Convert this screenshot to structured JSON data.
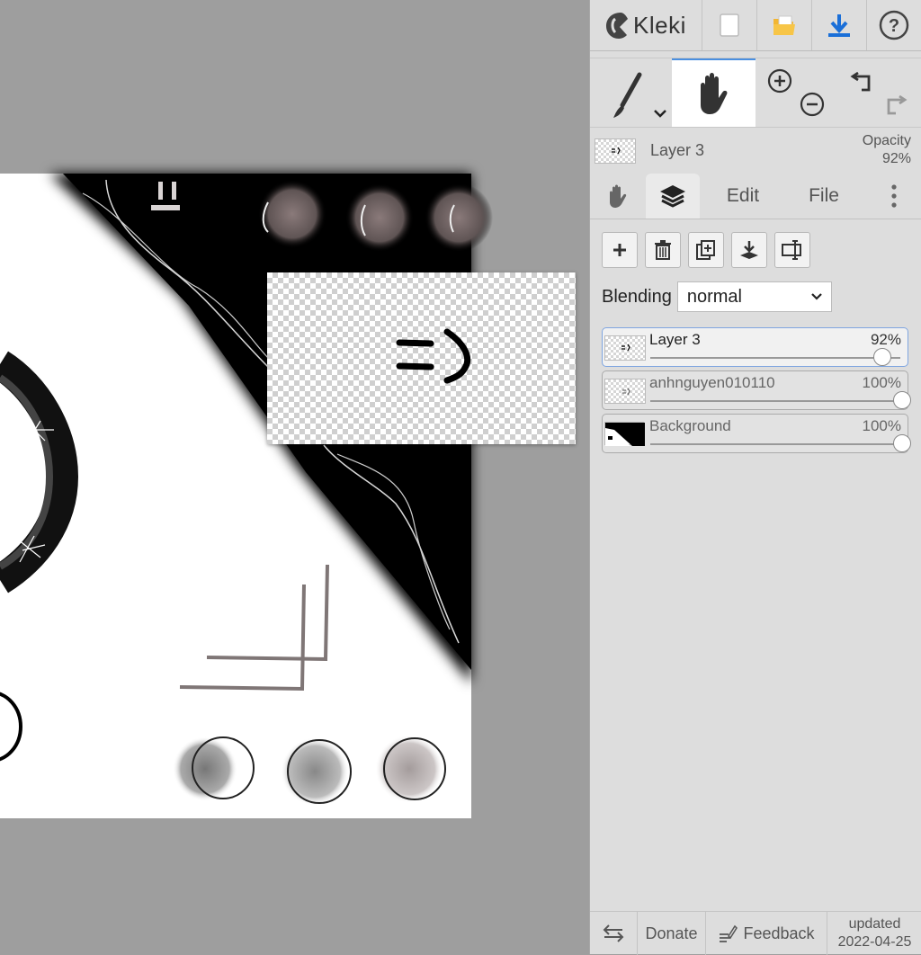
{
  "app": {
    "logo_text": "Kleki",
    "logo_icon": "kleki-logo-icon"
  },
  "top_buttons": [
    {
      "name": "new-image-button",
      "icon": "new-page-icon"
    },
    {
      "name": "open-image-button",
      "icon": "folder-icon"
    },
    {
      "name": "save-image-button",
      "icon": "download-icon"
    },
    {
      "name": "help-button",
      "icon": "help-icon"
    }
  ],
  "tools": {
    "brush": "brush-icon",
    "hand": "hand-icon",
    "zoom_in": "zoom-in-icon",
    "zoom_out": "zoom-out-icon",
    "undo": "undo-icon",
    "redo": "redo-icon"
  },
  "current_layer": {
    "name": "Layer 3",
    "opacity_label": "Opacity",
    "opacity_value": "92%"
  },
  "tabs": {
    "edit": "Edit",
    "file": "File"
  },
  "blending": {
    "label": "Blending",
    "value": "normal"
  },
  "layers": [
    {
      "name": "Layer 3",
      "opacity": "92%",
      "opacity_fraction": 0.92,
      "active": true
    },
    {
      "name": "anhnguyen010110",
      "opacity": "100%",
      "opacity_fraction": 1.0,
      "active": false
    },
    {
      "name": "Background",
      "opacity": "100%",
      "opacity_fraction": 1.0,
      "active": false
    }
  ],
  "footer": {
    "donate": "Donate",
    "feedback": "Feedback",
    "updated_label": "updated",
    "updated_date": "2022-04-25"
  },
  "colors": {
    "accent": "#4a8fe0",
    "download_blue": "#1a6fd8",
    "folder_yellow": "#f2b632",
    "sidebar_bg": "#dddddd",
    "workspace_bg": "#9e9e9e"
  }
}
